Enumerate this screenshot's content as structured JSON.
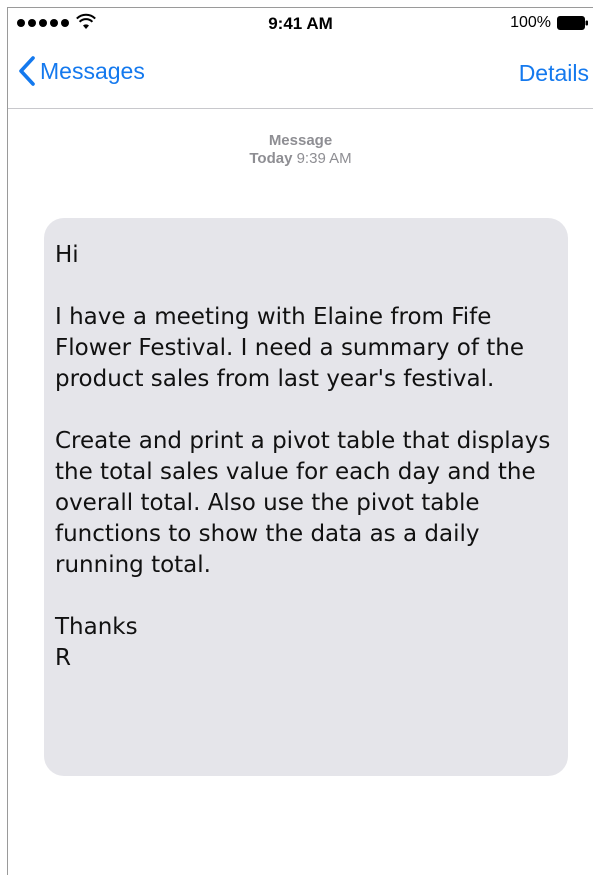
{
  "status_bar": {
    "time": "9:41 AM",
    "battery": "100%",
    "signal_icon": "signal-dots-icon",
    "wifi_icon": "wifi-icon",
    "battery_icon": "battery-icon"
  },
  "nav": {
    "back_label": "Messages",
    "details_label": "Details",
    "accent_color": "#1479ee"
  },
  "message_header": {
    "type": "Message",
    "day": "Today",
    "time": "9:39 AM"
  },
  "message": {
    "greeting": "Hi",
    "paragraph1": "I have a meeting with Elaine from Fife Flower Festival. I need a summary of the product sales from last year's festival.",
    "paragraph2": "Create and print a pivot table that displays the total sales value for each day and the overall total. Also use the pivot table functions to show the data as a daily running total.",
    "signoff": "Thanks",
    "signature": "R",
    "bubble_color": "#e5e5ea"
  }
}
